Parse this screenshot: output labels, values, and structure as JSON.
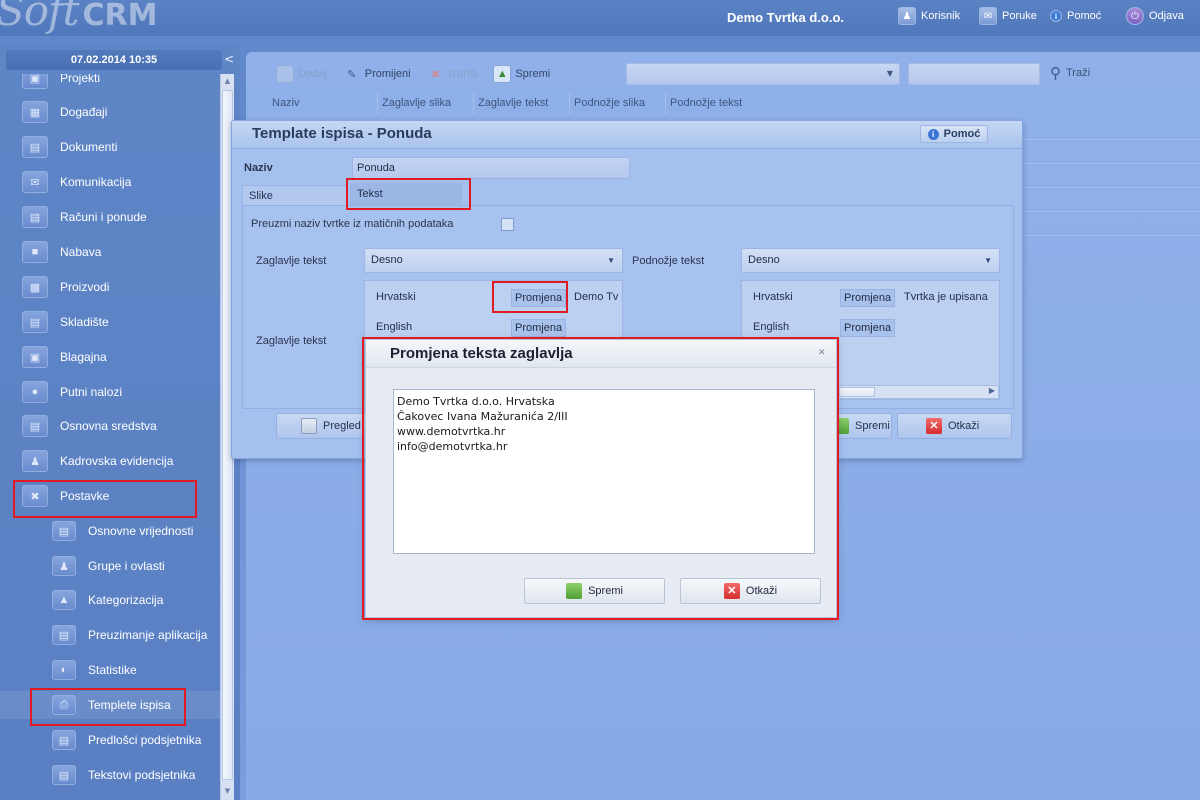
{
  "app": {
    "logo_soft": "Soft",
    "logo_crm": "CRM",
    "company": "Demo Tvrtka d.o.o."
  },
  "topnav": [
    {
      "label": "Korisnik",
      "icon": "user-icon"
    },
    {
      "label": "Poruke",
      "icon": "messages-icon"
    },
    {
      "label": "Pomoć",
      "icon": "help-icon"
    },
    {
      "label": "Odjava",
      "icon": "logout-icon"
    }
  ],
  "sidebar": {
    "datetime": "07.02.2014 10:35",
    "collapse": "<",
    "items": [
      {
        "label": "Projekti",
        "icon": "projects-icon"
      },
      {
        "label": "Događaji",
        "icon": "events-icon"
      },
      {
        "label": "Dokumenti",
        "icon": "documents-icon"
      },
      {
        "label": "Komunikacija",
        "icon": "communication-icon"
      },
      {
        "label": "Računi i ponude",
        "icon": "invoices-icon"
      },
      {
        "label": "Nabava",
        "icon": "procurement-icon"
      },
      {
        "label": "Proizvodi",
        "icon": "products-icon"
      },
      {
        "label": "Skladište",
        "icon": "warehouse-icon"
      },
      {
        "label": "Blagajna",
        "icon": "cashbox-icon"
      },
      {
        "label": "Putni nalozi",
        "icon": "travel-icon"
      },
      {
        "label": "Osnovna sredstva",
        "icon": "assets-icon"
      },
      {
        "label": "Kadrovska evidencija",
        "icon": "hr-icon"
      },
      {
        "label": "Postavke",
        "icon": "settings-icon"
      }
    ],
    "subitems": [
      {
        "label": "Osnovne vrijednosti",
        "icon": "basic-values-icon"
      },
      {
        "label": "Grupe i ovlasti",
        "icon": "groups-icon"
      },
      {
        "label": "Kategorizacija",
        "icon": "categories-icon"
      },
      {
        "label": "Preuzimanje aplikacija",
        "icon": "download-icon"
      },
      {
        "label": "Statistike",
        "icon": "statistics-icon"
      },
      {
        "label": "Templete ispisa",
        "icon": "print-template-icon"
      },
      {
        "label": "Predlošci podsjetnika",
        "icon": "reminder-template-icon"
      },
      {
        "label": "Tekstovi podsjetnika",
        "icon": "reminder-text-icon"
      }
    ]
  },
  "toolbar": {
    "add": "Dodaj",
    "change": "Promijeni",
    "delete": "Izbriši",
    "save": "Spremi",
    "search": "Traži"
  },
  "grid": {
    "columns": [
      "Naziv",
      "Zaglavlje slika",
      "Zaglavlje tekst",
      "Podnožje slika",
      "Podnožje tekst"
    ]
  },
  "template_dialog": {
    "title": "Template ispisa - Ponuda",
    "help": "Pomoć",
    "name_label": "Naziv",
    "name_value": "Ponuda",
    "tabs": [
      "Slike",
      "Tekst"
    ],
    "take_company_label": "Preuzmi naziv tvrtke iz matičnih podataka",
    "header_text_label": "Zaglavlje tekst",
    "header_text_value": "Desno",
    "footer_text_label": "Podnožje tekst",
    "footer_text_value": "Desno",
    "header_text_label_2": "Zaglavlje tekst",
    "header_langs": [
      {
        "lang": "Hrvatski",
        "button": "Promjena",
        "preview": "Demo Tv"
      },
      {
        "lang": "English",
        "button": "Promjena",
        "preview": ""
      }
    ],
    "footer_langs": [
      {
        "lang": "Hrvatski",
        "button": "Promjena",
        "preview": "Tvrtka je upisana"
      },
      {
        "lang": "English",
        "button": "Promjena",
        "preview": ""
      }
    ],
    "preview_btn": "Pregled",
    "save_btn": "Spremi",
    "cancel_btn": "Otkaži"
  },
  "edit_dialog": {
    "title": "Promjena teksta zaglavlja",
    "lines": [
      "Demo Tvrtka d.o.o. Hrvatska",
      "Čakovec Ivana Mažuranića 2/III",
      "www.demotvrtka.hr",
      "info@demotvrtka.hr"
    ],
    "save": "Spremi",
    "cancel": "Otkaži"
  },
  "colors": {
    "highlight": "#e01b22",
    "accent": "#5b82c4"
  }
}
